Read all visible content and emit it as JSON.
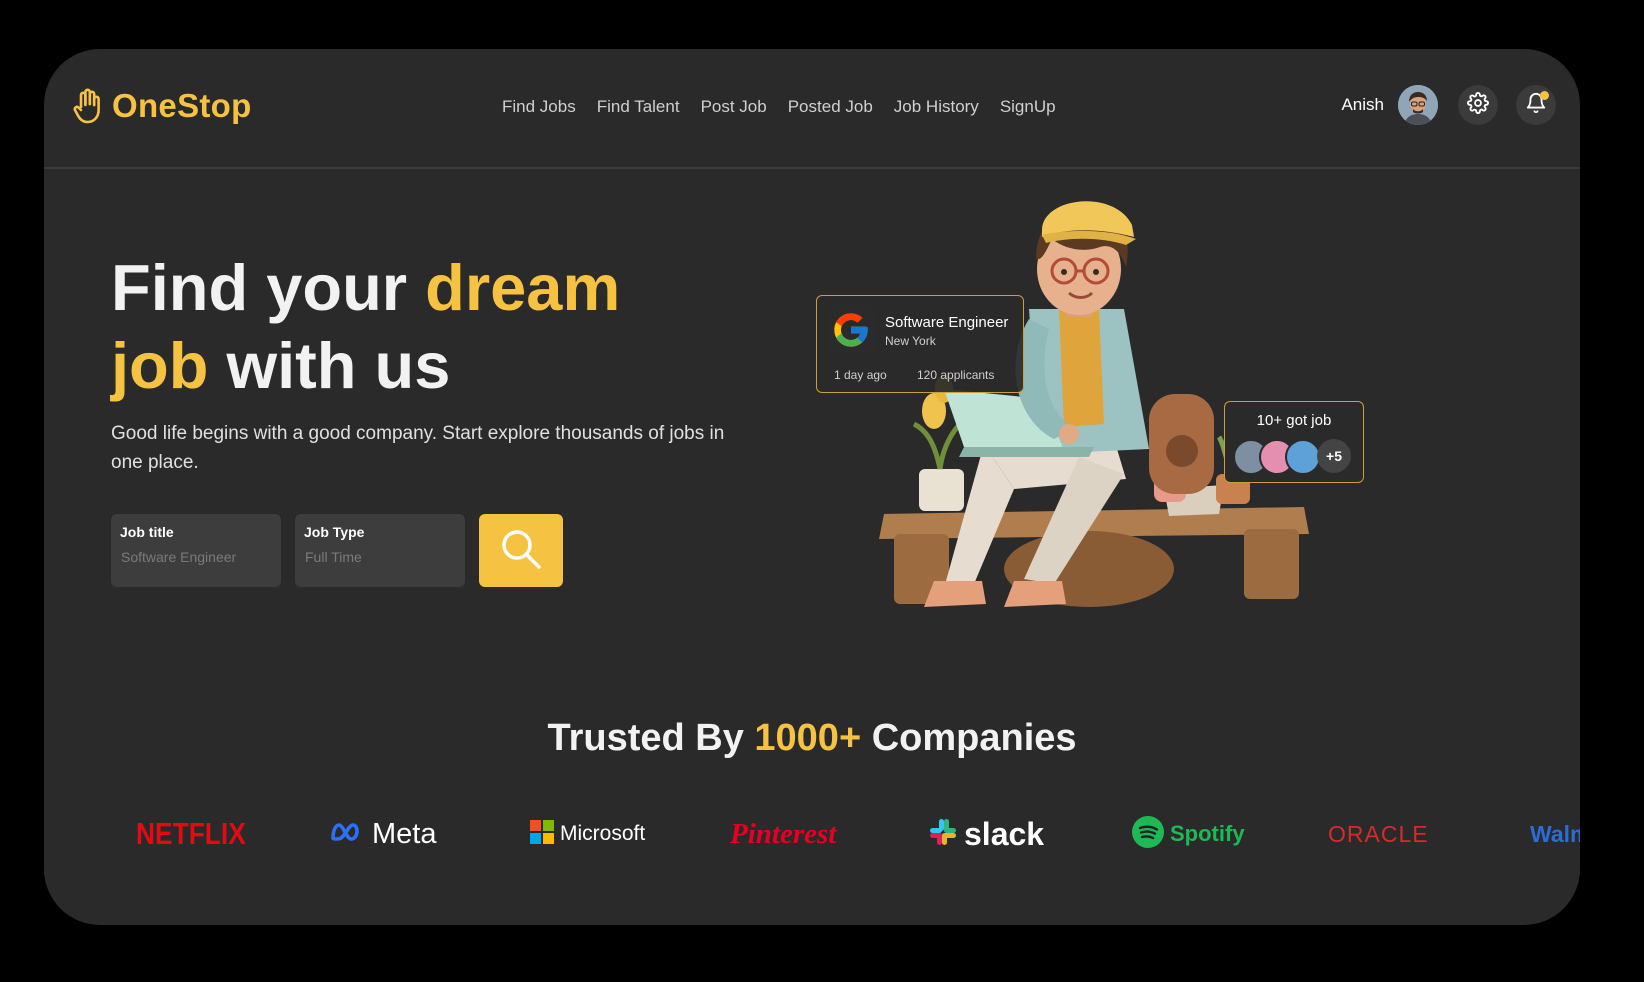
{
  "app": {
    "brand_name": "OneStop",
    "brand_icon": "hand-icon",
    "accent_color": "#f5c242",
    "background_color": "#2a2a2a"
  },
  "nav": {
    "items": [
      "Find Jobs",
      "Find Talent",
      "Post Job",
      "Posted Job",
      "Job History",
      "SignUp"
    ],
    "user_name": "Anish",
    "settings_icon": "gear-icon",
    "notification_icon": "bell-icon"
  },
  "hero": {
    "title_part1": "Find your ",
    "title_accent1": "dream",
    "title_accent2": "job",
    "title_part2": " with us",
    "subtitle": "Good life begins with a good company. Start explore thousands of jobs in one place.",
    "job_title_label": "Job title",
    "job_title_placeholder": "Software Engineer",
    "job_type_label": "Job Type",
    "job_type_placeholder": "Full Time",
    "search_icon": "search-icon"
  },
  "job_card": {
    "title": "Software Engineer",
    "location": "New York",
    "posted": "1 day ago",
    "applicants": "120 applicants"
  },
  "got_job": {
    "label": "10+ got job",
    "more": "+5"
  },
  "trusted": {
    "prefix": "Trusted By ",
    "accent": "1000+",
    "suffix": " Companies"
  },
  "companies": [
    "NETFLIX",
    "Meta",
    "Microsoft",
    "Pinterest",
    "slack",
    "Spotify",
    "ORACLE",
    "Walmart"
  ]
}
